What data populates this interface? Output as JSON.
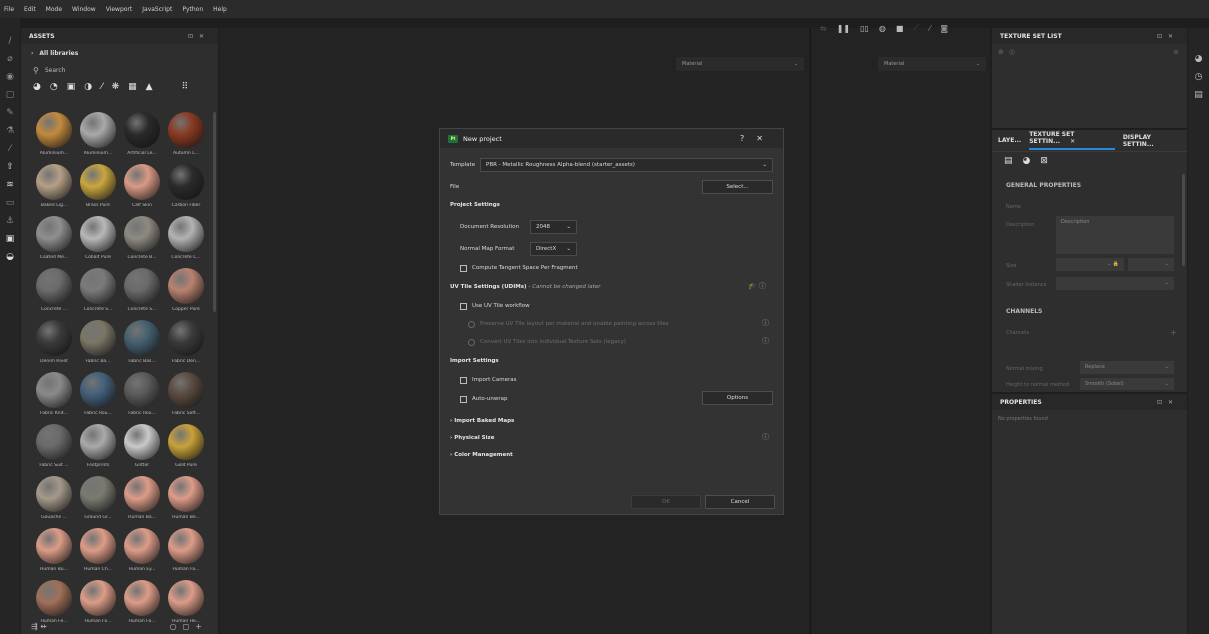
{
  "menu": [
    "File",
    "Edit",
    "Mode",
    "Window",
    "Viewport",
    "JavaScript",
    "Python",
    "Help"
  ],
  "assets": {
    "title": "ASSETS",
    "library": "All libraries",
    "search_placeholder": "Search",
    "materials": [
      {
        "name": "Aluminium...",
        "color": "#c38a3e"
      },
      {
        "name": "Aluminium...",
        "color": "#a9a9a9"
      },
      {
        "name": "Artificial Le...",
        "color": "#2a2a2a"
      },
      {
        "name": "Autumn L...",
        "color": "#8a3a22"
      },
      {
        "name": "Baked Lig...",
        "color": "#b5a086"
      },
      {
        "name": "Brass Pure",
        "color": "#c9a640"
      },
      {
        "name": "Calf Skin",
        "color": "#d99a85"
      },
      {
        "name": "Carbon Fiber",
        "color": "#2b2b2b"
      },
      {
        "name": "Coated Me...",
        "color": "#8f8f8f"
      },
      {
        "name": "Cobalt Pure",
        "color": "#b8b8b8"
      },
      {
        "name": "Concrete B...",
        "color": "#8e8a82"
      },
      {
        "name": "Concrete C...",
        "color": "#b3b3b3"
      },
      {
        "name": "Concrete ...",
        "color": "#6b6b6b"
      },
      {
        "name": "Concrete S...",
        "color": "#7a7a7a"
      },
      {
        "name": "Concrete S...",
        "color": "#6a6a6a"
      },
      {
        "name": "Copper Pure",
        "color": "#b88270"
      },
      {
        "name": "Denim Rivet",
        "color": "#3a3a3a"
      },
      {
        "name": "Fabric Ba...",
        "color": "#7a7766"
      },
      {
        "name": "Fabric Bas...",
        "color": "#456070"
      },
      {
        "name": "Fabric Den...",
        "color": "#3a3a3a"
      },
      {
        "name": "Fabric Knit...",
        "color": "#8a8a8a"
      },
      {
        "name": "Fabric Rou...",
        "color": "#44607a"
      },
      {
        "name": "Fabric Rou...",
        "color": "#5a5a5a"
      },
      {
        "name": "Fabric Soft...",
        "color": "#5a4a40"
      },
      {
        "name": "Fabric Suit ...",
        "color": "#6a6a6a"
      },
      {
        "name": "Footprints",
        "color": "#aaaaaa"
      },
      {
        "name": "Glitter",
        "color": "#c9c9c9"
      },
      {
        "name": "Gold Pure",
        "color": "#c9a23a"
      },
      {
        "name": "Gouache ...",
        "color": "#a59a8a"
      },
      {
        "name": "Ground Gr...",
        "color": "#7a7a70"
      },
      {
        "name": "Human Ba...",
        "color": "#dc9c88"
      },
      {
        "name": "Human Be...",
        "color": "#dc9c88"
      },
      {
        "name": "Human Bu...",
        "color": "#dc9c88"
      },
      {
        "name": "Human Ch...",
        "color": "#dc9c88"
      },
      {
        "name": "Human Ey...",
        "color": "#dc9c88"
      },
      {
        "name": "Human Fa...",
        "color": "#dc9c88"
      },
      {
        "name": "Human Fe...",
        "color": "#a0705a"
      },
      {
        "name": "Human Fo...",
        "color": "#dc9c88"
      },
      {
        "name": "Human Fo...",
        "color": "#dc9c88"
      },
      {
        "name": "Human He...",
        "color": "#dc9c88"
      }
    ]
  },
  "viewport": {
    "material_left": "Material",
    "material_right": "Material"
  },
  "texture_set_list": {
    "title": "TEXTURE SET LIST"
  },
  "texture_set_settings": {
    "tabs": [
      "LAYE...",
      "TEXTURE SET SETTIN...",
      "DISPLAY SETTIN..."
    ],
    "general": "GENERAL PROPERTIES",
    "name_label": "Name",
    "description_label": "Description",
    "description_placeholder": "Description",
    "size_label": "Size",
    "shader_label": "Shader Instance",
    "channels_title": "CHANNELS",
    "channels_label": "Channels",
    "normal_mixing_label": "Normal mixing",
    "normal_mixing_value": "Replace",
    "height_label": "Height to normal method",
    "height_value": "Smooth (Sobel)"
  },
  "properties": {
    "title": "PROPERTIES",
    "empty": "No properties found"
  },
  "dialog": {
    "title": "New project",
    "template_label": "Template",
    "template_value": "PBR - Metallic Roughness Alpha-blend (starter_assets)",
    "file_label": "File",
    "select_button": "Select...",
    "project_settings": "Project Settings",
    "doc_res_label": "Document Resolution",
    "doc_res_value": "2048",
    "normal_map_label": "Normal Map Format",
    "normal_map_value": "DirectX",
    "compute_tangent": "Compute Tangent Space Per Fragment",
    "uv_tile_title": "UV Tile Settings (UDIMs)",
    "uv_tile_note": "- Cannot be changed later",
    "use_uv_tile": "Use UV Tile workflow",
    "preserve_uv": "Preserve UV Tile layout per material and enable painting across tiles",
    "convert_uv": "Convert UV Tiles into individual Texture Sets (legacy)",
    "import_settings": "Import Settings",
    "import_cameras": "Import Cameras",
    "auto_unwrap": "Auto-unwrap",
    "options_button": "Options",
    "import_baked": "Import Baked Maps",
    "physical_size": "Physical Size",
    "color_management": "Color Management",
    "ok_button": "OK",
    "cancel_button": "Cancel"
  }
}
